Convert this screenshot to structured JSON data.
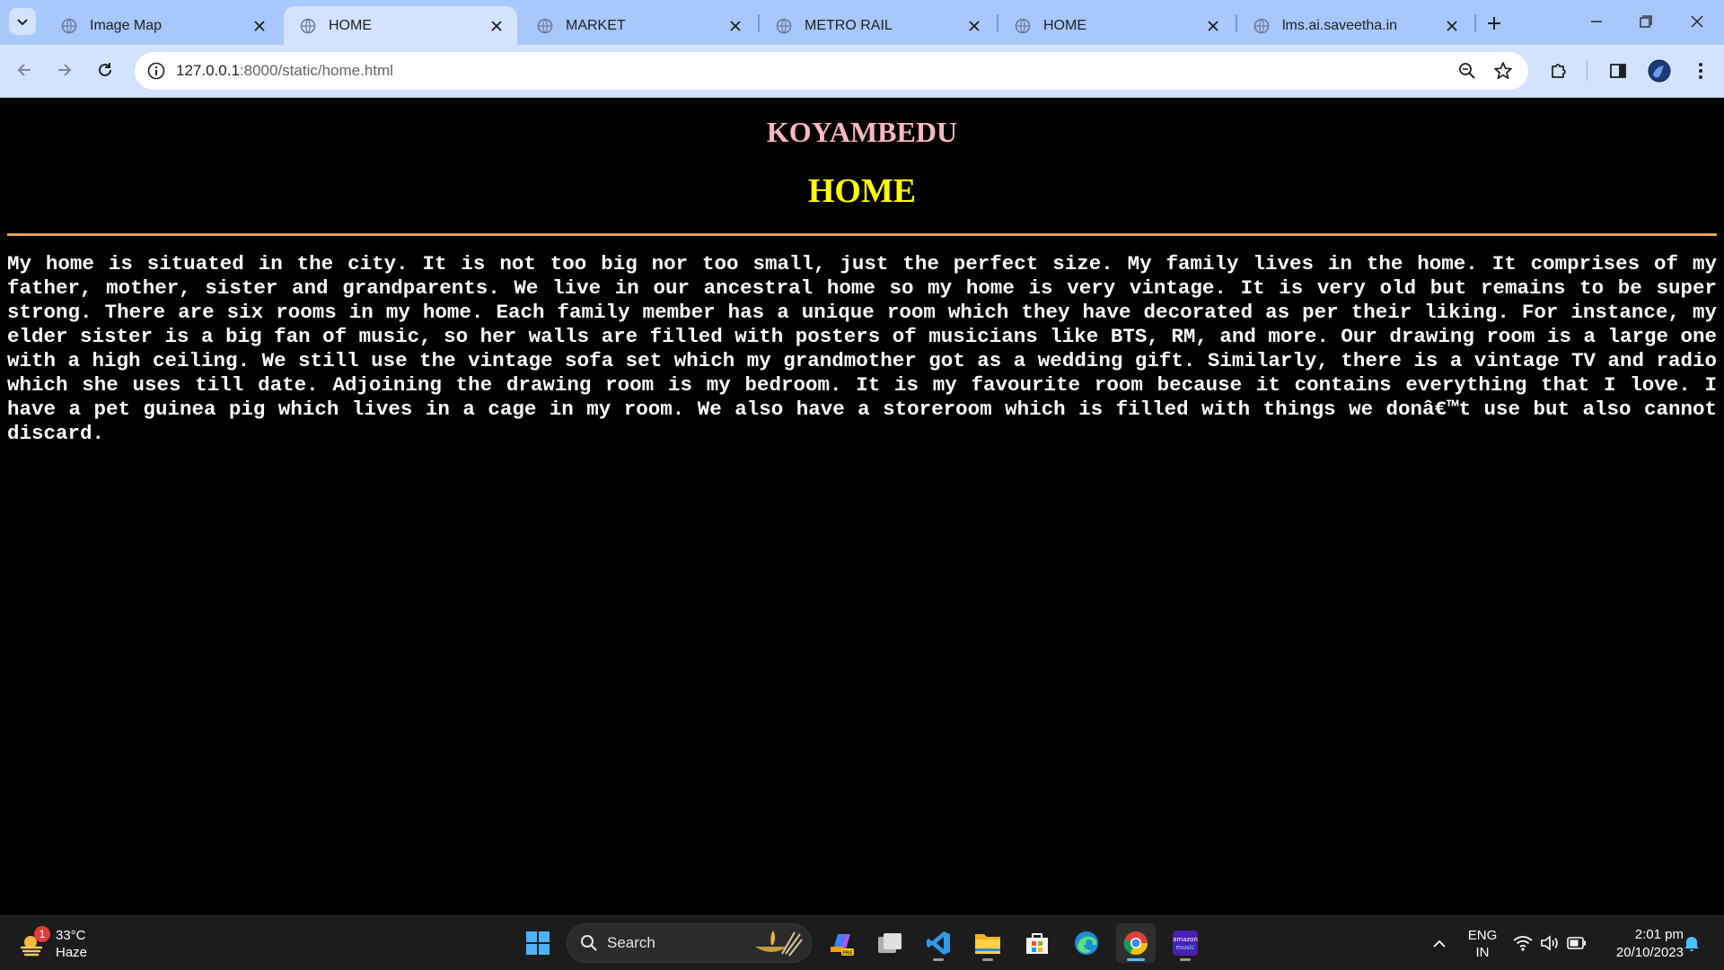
{
  "browser": {
    "tabs": [
      {
        "title": "Image Map",
        "active": false
      },
      {
        "title": "HOME",
        "active": true
      },
      {
        "title": "MARKET",
        "active": false
      },
      {
        "title": "METRO RAIL",
        "active": false
      },
      {
        "title": "HOME",
        "active": false
      },
      {
        "title": "lms.ai.saveetha.in",
        "active": false
      }
    ],
    "url_host": "127.0.0.1",
    "url_path": ":8000/static/home.html",
    "icons": [
      "tab-search-icon",
      "close-icon",
      "new-tab-icon",
      "minimize-icon",
      "restore-icon",
      "close-window-icon",
      "back-icon",
      "forward-icon",
      "reload-icon",
      "site-info-icon",
      "zoom-icon",
      "bookmark-star-icon",
      "extensions-icon",
      "side-panel-icon",
      "profile-avatar-icon",
      "menu-icon"
    ]
  },
  "page": {
    "site_title": "KOYAMBEDU",
    "heading": "HOME",
    "body": "My home is situated in the city. It is not too big nor too small, just the perfect size. My family lives in the home. It comprises of my father, mother, sister and grandparents. We live in our ancestral home so my home is very vintage. It is very old but remains to be super strong. There are six rooms in my home. Each family member has a unique room which they have decorated as per their liking. For instance, my elder sister is a big fan of music, so her walls are filled with posters of musicians like BTS, RM, and more. Our drawing room is a large one with a high ceiling. We still use the vintage sofa set which my grandmother got as a wedding gift. Similarly, there is a vintage TV and radio which she uses till date. Adjoining the drawing room is my bedroom. It is my favourite room because it contains everything that I love. I have a pet guinea pig which lives in a cage in my room. We also have a storeroom which is filled with things we donâ€™t use but also cannot discard.",
    "colors": {
      "background": "#000000",
      "site_title": "#ffb6c1",
      "heading": "#ffff00",
      "divider": "#e8a640",
      "body_text": "#ffffff"
    }
  },
  "taskbar": {
    "weather": {
      "badge": "1",
      "temp": "33°C",
      "condition": "Haze"
    },
    "search_label": "Search",
    "apps": [
      "windows-start-icon",
      "copilot-icon",
      "task-view-icon",
      "vscode-icon",
      "file-explorer-icon",
      "ms-store-icon",
      "edge-icon",
      "chrome-icon",
      "amazon-music-icon"
    ],
    "amazon_music_label": "amazon music",
    "lang_line1": "ENG",
    "lang_line2": "IN",
    "time": "2:01 pm",
    "date": "20/10/2023"
  }
}
